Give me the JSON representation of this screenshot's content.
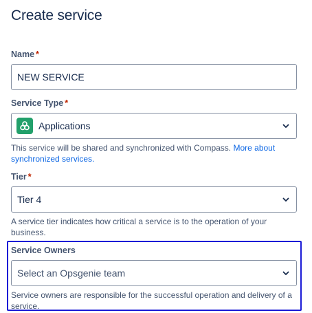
{
  "page": {
    "title": "Create service"
  },
  "name_field": {
    "label": "Name",
    "required_marker": "*",
    "value": "NEW SERVICE"
  },
  "service_type": {
    "label": "Service Type",
    "required_marker": "*",
    "selected": "Applications",
    "icon": "applications-icon",
    "helper_text": "This service will be shared and synchronized with Compass.",
    "helper_link": "More about synchronized services."
  },
  "tier": {
    "label": "Tier",
    "required_marker": "*",
    "selected": "Tier 4",
    "helper_text": "A service tier indicates how critical a service is to the operation of your business."
  },
  "service_owners": {
    "label": "Service Owners",
    "placeholder": "Select an Opsgenie team",
    "helper_text": "Service owners are responsible for the successful operation and delivery of a service."
  },
  "colors": {
    "required": "#bf2600",
    "link": "#0c66e4",
    "app_icon_bg": "#22a06b",
    "highlight_border": "#1a1ad6"
  }
}
